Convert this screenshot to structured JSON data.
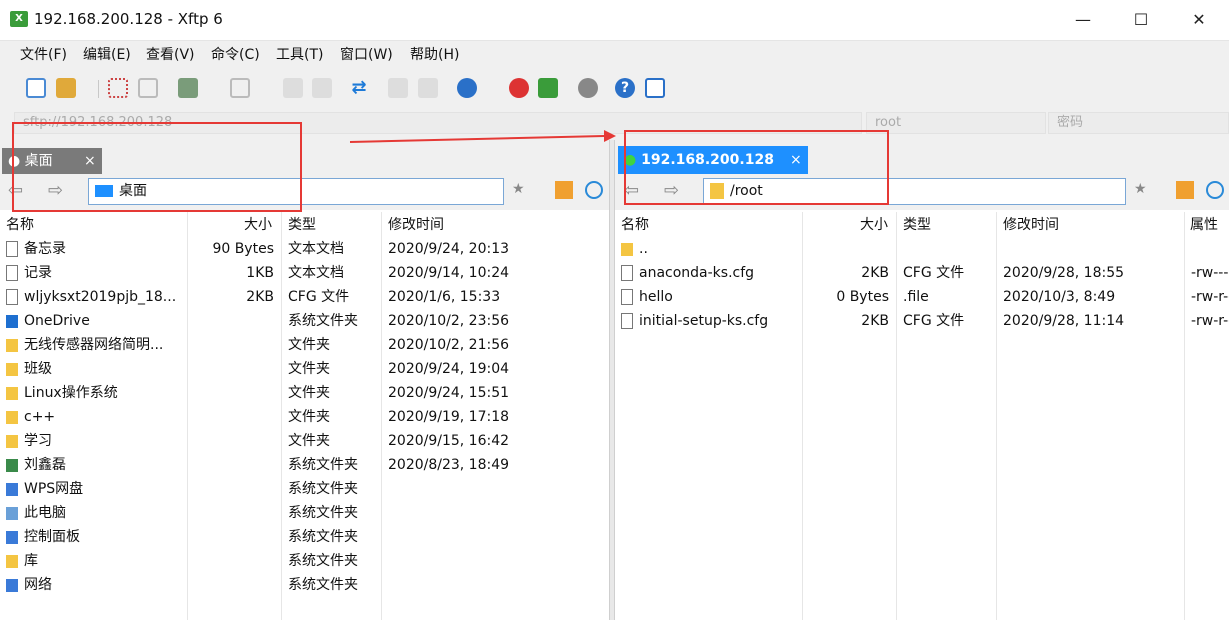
{
  "window": {
    "title": "192.168.200.128 - Xftp 6",
    "min": "—",
    "max": "☐",
    "close": "✕"
  },
  "menu": [
    "文件(F)",
    "编辑(E)",
    "查看(V)",
    "命令(C)",
    "工具(T)",
    "窗口(W)",
    "帮助(H)"
  ],
  "address": {
    "host": "sftp://192.168.200.128",
    "user": "root",
    "password_placeholder": "密码"
  },
  "left": {
    "tab": "桌面",
    "tab_close": "×",
    "path": "桌面",
    "columns": [
      "名称",
      "大小",
      "类型",
      "修改时间"
    ],
    "rows": [
      {
        "name": "备忘录",
        "size": "90 Bytes",
        "type": "文本文档",
        "modified": "2020/9/24, 20:13",
        "icon": "text-file-icon"
      },
      {
        "name": "记录",
        "size": "1KB",
        "type": "文本文档",
        "modified": "2020/9/14, 10:24",
        "icon": "text-file-icon"
      },
      {
        "name": "wljyksxt2019pjb_18...",
        "size": "2KB",
        "type": "CFG 文件",
        "modified": "2020/1/6, 15:33",
        "icon": "file-icon"
      },
      {
        "name": "OneDrive",
        "size": "",
        "type": "系统文件夹",
        "modified": "2020/10/2, 23:56",
        "icon": "cloud-icon"
      },
      {
        "name": "无线传感器网络简明...",
        "size": "",
        "type": "文件夹",
        "modified": "2020/10/2, 21:56",
        "icon": "folder-icon"
      },
      {
        "name": "班级",
        "size": "",
        "type": "文件夹",
        "modified": "2020/9/24, 19:04",
        "icon": "folder-icon"
      },
      {
        "name": "Linux操作系统",
        "size": "",
        "type": "文件夹",
        "modified": "2020/9/24, 15:51",
        "icon": "folder-icon"
      },
      {
        "name": "c++",
        "size": "",
        "type": "文件夹",
        "modified": "2020/9/19, 17:18",
        "icon": "folder-icon"
      },
      {
        "name": "学习",
        "size": "",
        "type": "文件夹",
        "modified": "2020/9/15, 16:42",
        "icon": "folder-icon"
      },
      {
        "name": "刘鑫磊",
        "size": "",
        "type": "系统文件夹",
        "modified": "2020/8/23, 18:49",
        "icon": "user-folder-icon"
      },
      {
        "name": "WPS网盘",
        "size": "",
        "type": "系统文件夹",
        "modified": "",
        "icon": "cloud-drive-icon"
      },
      {
        "name": "此电脑",
        "size": "",
        "type": "系统文件夹",
        "modified": "",
        "icon": "computer-icon"
      },
      {
        "name": "控制面板",
        "size": "",
        "type": "系统文件夹",
        "modified": "",
        "icon": "control-panel-icon"
      },
      {
        "name": "库",
        "size": "",
        "type": "系统文件夹",
        "modified": "",
        "icon": "library-icon"
      },
      {
        "name": "网络",
        "size": "",
        "type": "系统文件夹",
        "modified": "",
        "icon": "network-icon"
      }
    ]
  },
  "right": {
    "tab": "192.168.200.128",
    "tab_close": "×",
    "path": "/root",
    "columns": [
      "名称",
      "大小",
      "类型",
      "修改时间",
      "属性"
    ],
    "rows": [
      {
        "name": "..",
        "size": "",
        "type": "",
        "modified": "",
        "attr": "",
        "icon": "folder-icon"
      },
      {
        "name": "anaconda-ks.cfg",
        "size": "2KB",
        "type": "CFG 文件",
        "modified": "2020/9/28, 18:55",
        "attr": "-rw-----",
        "icon": "file-icon"
      },
      {
        "name": "hello",
        "size": "0 Bytes",
        "type": ".file",
        "modified": "2020/10/3, 8:49",
        "attr": "-rw-r--",
        "icon": "file-icon"
      },
      {
        "name": "initial-setup-ks.cfg",
        "size": "2KB",
        "type": "CFG 文件",
        "modified": "2020/9/28, 11:14",
        "attr": "-rw-r--",
        "icon": "file-icon"
      }
    ]
  },
  "colors": {
    "accent": "#1e90ff",
    "annotation": "#e53935",
    "folder": "#f4c542"
  }
}
